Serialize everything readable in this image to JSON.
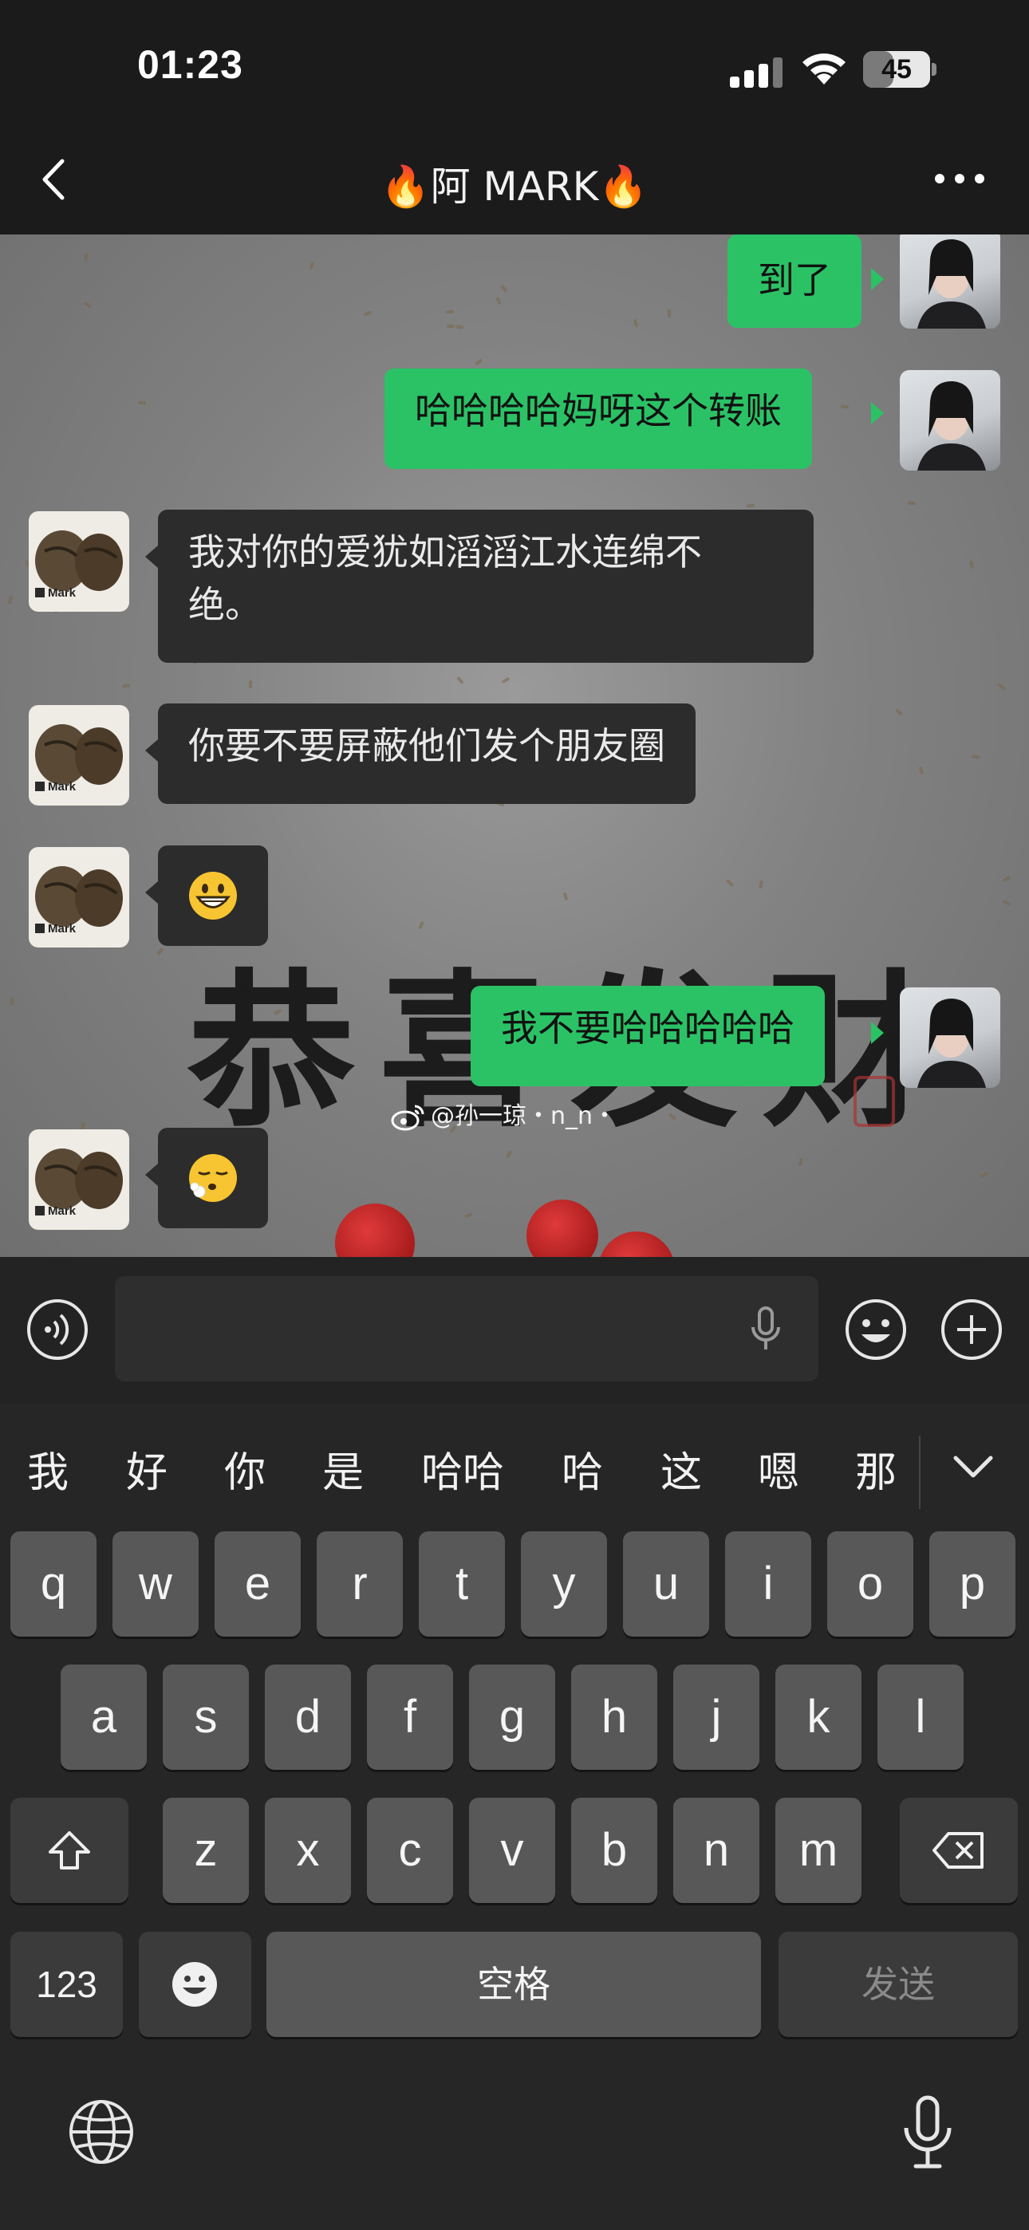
{
  "status_bar": {
    "time": "01:23",
    "battery_level": "45",
    "battery_fraction": 0.45,
    "icons": [
      "signal-icon",
      "wifi-icon",
      "battery-icon"
    ]
  },
  "nav": {
    "title": "🔥阿 MARK🔥",
    "back_icon": "chevron-left-icon",
    "more_icon": "ellipsis-icon"
  },
  "messages": [
    {
      "side": "out",
      "text": "到了",
      "avatar": "my-avatar"
    },
    {
      "side": "out",
      "text": "哈哈哈哈妈呀这个转账",
      "avatar": "my-avatar"
    },
    {
      "side": "in",
      "line1": "我对你的爱犹如滔滔江水连绵不",
      "line2": "绝。",
      "avatar": "mark-avatar"
    },
    {
      "side": "in",
      "text": "你要不要屏蔽他们发个朋友圈",
      "avatar": "mark-avatar"
    },
    {
      "side": "in",
      "emoji": "grinning-face-icon",
      "avatar": "mark-avatar"
    },
    {
      "side": "out",
      "text": "我不要哈哈哈哈哈",
      "avatar": "my-avatar"
    },
    {
      "side": "in",
      "emoji": "face-exhaling-icon",
      "avatar": "mark-avatar"
    }
  ],
  "avatar_mark_label": "Mark",
  "wallpaper": {
    "calligraphy": "恭喜发财",
    "watermark": "@孙一琼・n_n・"
  },
  "input_bar": {
    "placeholder": "",
    "icons": [
      "voice-icon",
      "microphone-icon",
      "emoji-icon",
      "plus-icon"
    ]
  },
  "keyboard": {
    "candidates": [
      "我",
      "好",
      "你",
      "是",
      "哈哈",
      "哈",
      "这",
      "嗯",
      "那"
    ],
    "row1": [
      "q",
      "w",
      "e",
      "r",
      "t",
      "y",
      "u",
      "i",
      "o",
      "p"
    ],
    "row2": [
      "a",
      "s",
      "d",
      "f",
      "g",
      "h",
      "j",
      "k",
      "l"
    ],
    "row3": [
      "z",
      "x",
      "c",
      "v",
      "b",
      "n",
      "m"
    ],
    "numbers_key": "123",
    "space_key": "空格",
    "send_key": "发送"
  },
  "colors": {
    "sent_bubble": "#2bc266",
    "received_bubble": "#2c2c2c",
    "background": "#1b1b1b"
  }
}
